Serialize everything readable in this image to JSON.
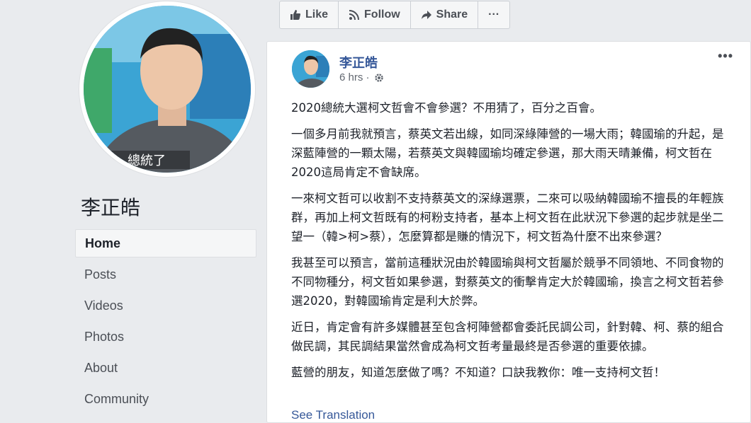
{
  "profile": {
    "name": "李正皓",
    "photo_caption": "總統了"
  },
  "nav": {
    "items": [
      {
        "label": "Home",
        "active": true
      },
      {
        "label": "Posts"
      },
      {
        "label": "Videos"
      },
      {
        "label": "Photos"
      },
      {
        "label": "About"
      },
      {
        "label": "Community"
      }
    ]
  },
  "actions": {
    "like_label": "Like",
    "follow_label": "Follow",
    "share_label": "Share",
    "more_label": "···"
  },
  "post": {
    "author": "李正皓",
    "time": "6 hrs ·",
    "menu": "•••",
    "paragraphs": [
      "2020總統大選柯文哲會不會參選？不用猜了，百分之百會。",
      "一個多月前我就預言，蔡英文若出線，如同深綠陣營的一場大雨；韓國瑜的升起，是深藍陣營的一顆太陽，若蔡英文與韓國瑜均確定參選，那大雨天晴兼備，柯文哲在2020這局肯定不會缺席。",
      "一來柯文哲可以收割不支持蔡英文的深綠選票，二來可以吸納韓國瑜不擅長的年輕族群，再加上柯文哲既有的柯粉支持者，基本上柯文哲在此狀況下參選的起步就是坐二望一（韓>柯>蔡），怎麼算都是賺的情況下，柯文哲為什麼不出來參選？",
      "我甚至可以預言，當前這種狀況由於韓國瑜與柯文哲屬於競爭不同領地、不同食物的不同物種分，柯文哲如果參選，對蔡英文的衝擊肯定大於韓國瑜，換言之柯文哲若參選2020，對韓國瑜肯定是利大於弊。",
      "近日，肯定會有許多媒體甚至包含柯陣營都會委託民調公司，針對韓、柯、蔡的組合做民調，其民調結果當然會成為柯文哲考量最終是否參選的重要依據。",
      "藍營的朋友，知道怎麼做了嗎？不知道？口訣我教你：唯一支持柯文哲！"
    ],
    "see_translation": "See Translation"
  },
  "icons": {
    "like": "thumbs-up-icon",
    "follow": "rss-icon",
    "share": "share-arrow-icon",
    "privacy": "gear-icon"
  },
  "colors": {
    "link": "#365899",
    "page_bg": "#e9ebee"
  }
}
